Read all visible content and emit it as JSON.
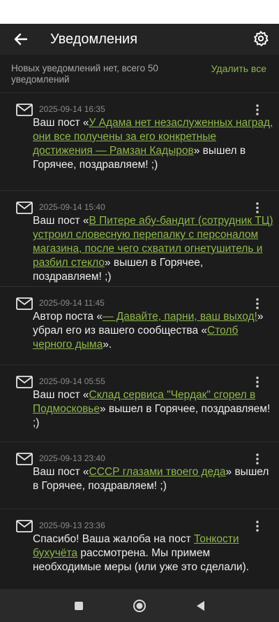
{
  "header": {
    "title": "Уведомления"
  },
  "summary": {
    "text": "Новых уведомлений нет, всего 50 уведомлений",
    "clear_all_label": "Удалить все"
  },
  "notifications": [
    {
      "date": "2025-09-14 16:35",
      "prefix": "Ваш пост «",
      "link": "У Адама нет незаслуженных наград, они все получены за его конкретные достижения — Рамзан Кадыров",
      "suffix": "» вышел в Горячее, поздравляем! ;)"
    },
    {
      "date": "2025-09-14 15:40",
      "prefix": "Ваш пост «",
      "link": "В Питере абу-бандит (сотрудник ТЦ) устроил словесную перепалку с персоналом магазина, после чего схватил огнетушитель и разбил стекло",
      "suffix": "» вышел в Горячее, поздравляем! ;)"
    },
    {
      "date": "2025-09-14 11:45",
      "prefix": "Автор поста «",
      "link": "— Давайте, парни, ваш выход!",
      "middle": "» убрал его из вашего сообщества «",
      "link2": "Столб черного дыма",
      "suffix": "»."
    },
    {
      "date": "2025-09-14 05:55",
      "prefix": "Ваш пост «",
      "link": "Склад сервиса \"Чердак\" сгорел в Подмосковье",
      "suffix": "» вышел в Горячее, поздравляем! ;)"
    },
    {
      "date": "2025-09-13 23:40",
      "prefix": "Ваш пост «",
      "link": "СССР глазами твоего деда",
      "suffix": "» вышел в Горячее, поздравляем! ;)"
    },
    {
      "date": "2025-09-13 23:36",
      "prefix": "Спасибо! Ваша жалоба на пост ",
      "link": "Тонкости бухучёта",
      "suffix": " рассмотрена. Мы примем необходимые меры (или уже это сделали)."
    }
  ],
  "colors": {
    "background": "#1c1c1c",
    "appbar": "#242424",
    "accent": "#8fb84d",
    "muted": "#8a8a8a",
    "navbar": "#2a2a2a"
  },
  "icons": {
    "back": "arrow-left-icon",
    "settings": "gear-icon",
    "notification": "envelope-icon",
    "menu": "more-vertical-icon",
    "nav_recent": "square-icon",
    "nav_home": "circle-icon",
    "nav_back": "triangle-back-icon"
  }
}
